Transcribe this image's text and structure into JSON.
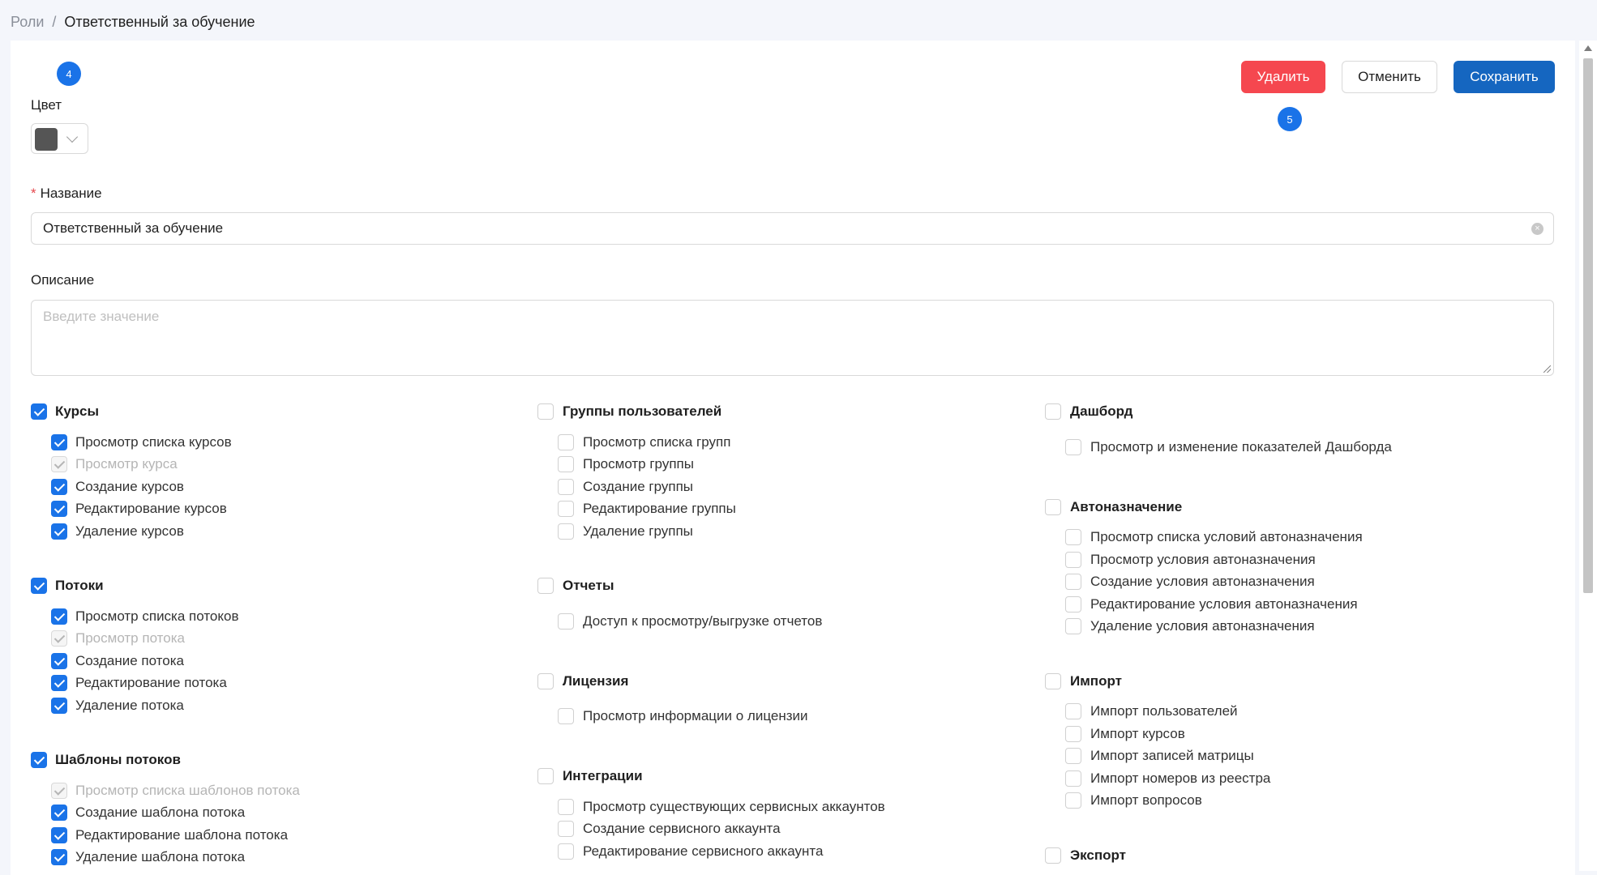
{
  "breadcrumb": {
    "parent": "Роли",
    "separator": "/",
    "current": "Ответственный за обучение"
  },
  "badges": {
    "b4": "4",
    "b5": "5"
  },
  "actions": {
    "delete": "Удалить",
    "cancel": "Отменить",
    "save": "Сохранить"
  },
  "form": {
    "color_label": "Цвет",
    "color_value": "#555555",
    "name_required_mark": "*",
    "name_label": "Название",
    "name_value": "Ответственный за обучение",
    "description_label": "Описание",
    "description_placeholder": "Введите значение"
  },
  "groups": {
    "courses": {
      "title": "Курсы",
      "items": [
        "Просмотр списка курсов",
        "Просмотр курса",
        "Создание курсов",
        "Редактирование курсов",
        "Удаление курсов"
      ]
    },
    "streams": {
      "title": "Потоки",
      "items": [
        "Просмотр списка потоков",
        "Просмотр потока",
        "Создание потока",
        "Редактирование потока",
        "Удаление потока"
      ]
    },
    "stream_templates": {
      "title": "Шаблоны потоков",
      "items": [
        "Просмотр списка шаблонов потока",
        "Создание шаблона потока",
        "Редактирование шаблона потока",
        "Удаление шаблона потока"
      ]
    },
    "user_groups": {
      "title": "Группы пользователей",
      "items": [
        "Просмотр списка групп",
        "Просмотр группы",
        "Создание группы",
        "Редактирование группы",
        "Удаление группы"
      ]
    },
    "reports": {
      "title": "Отчеты",
      "items": [
        "Доступ к просмотру/выгрузке отчетов"
      ]
    },
    "license": {
      "title": "Лицензия",
      "items": [
        "Просмотр информации о лицензии"
      ]
    },
    "integrations": {
      "title": "Интеграции",
      "items": [
        "Просмотр существующих сервисных аккаунтов",
        "Создание сервисного аккаунта",
        "Редактирование сервисного аккаунта"
      ]
    },
    "dashboard": {
      "title": "Дашборд",
      "items": [
        "Просмотр и изменение показателей Дашборда"
      ]
    },
    "autoassign": {
      "title": "Автоназначение",
      "items": [
        "Просмотр списка условий автоназначения",
        "Просмотр условия автоназначения",
        "Создание условия автоназначения",
        "Редактирование условия автоназначения",
        "Удаление условия автоназначения"
      ]
    },
    "import": {
      "title": "Импорт",
      "items": [
        "Импорт пользователей",
        "Импорт курсов",
        "Импорт записей матрицы",
        "Импорт номеров из реестра",
        "Импорт вопросов"
      ]
    },
    "export": {
      "title": "Экспорт"
    }
  }
}
